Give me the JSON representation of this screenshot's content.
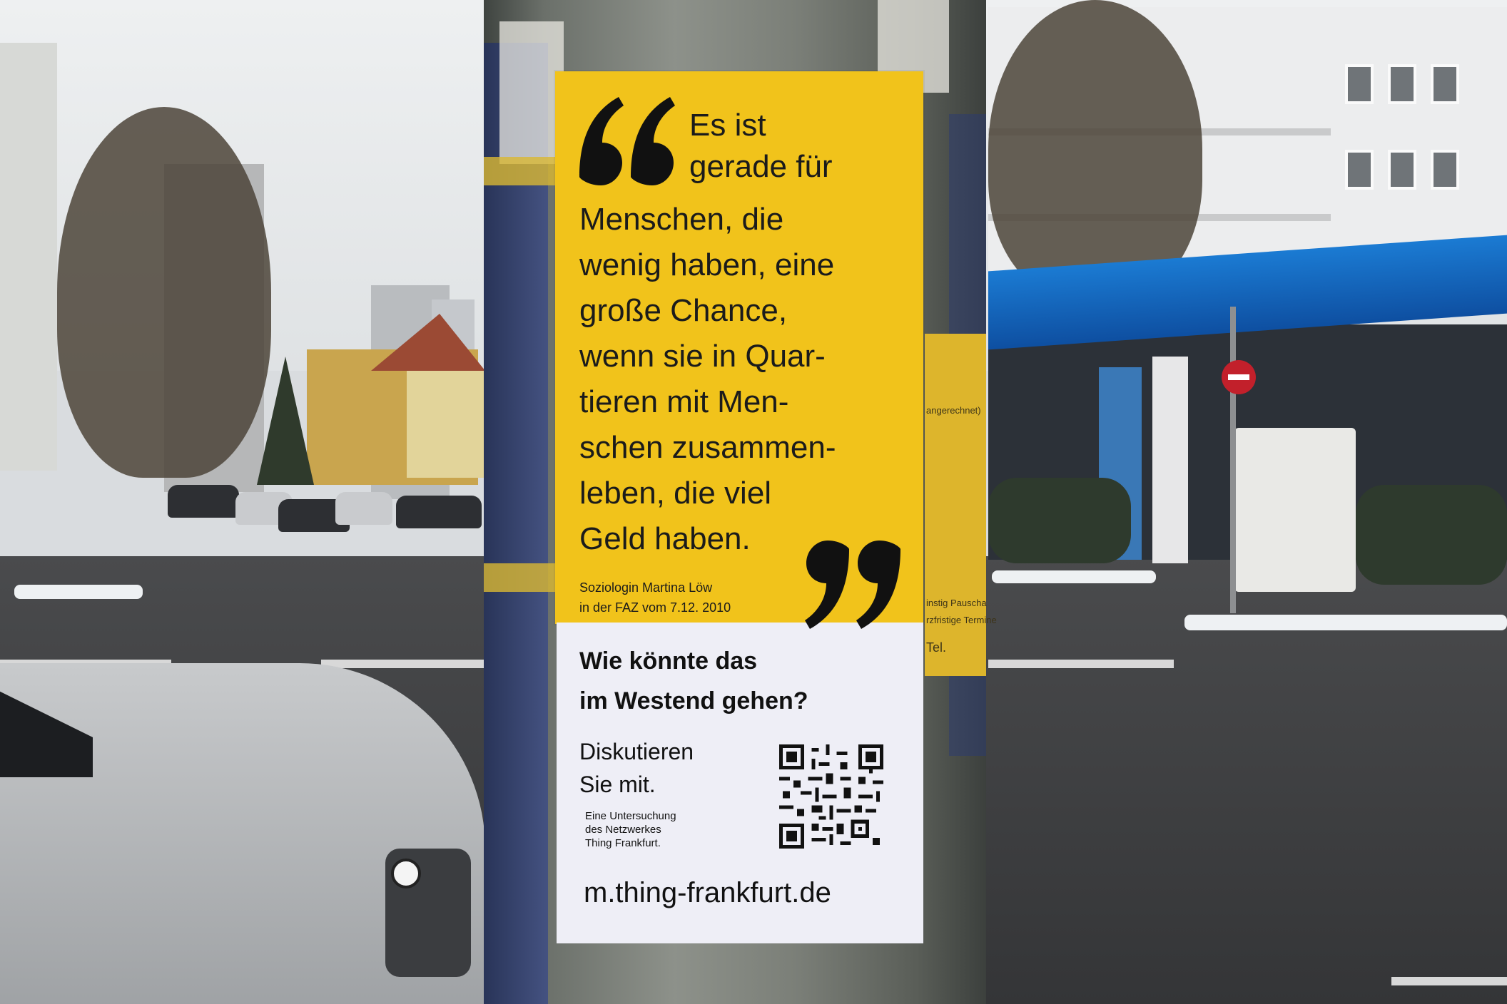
{
  "poster": {
    "quote_lines": [
      "Es ist",
      "gerade für",
      "Menschen, die",
      "wenig haben, eine",
      "große Chance,",
      "wenn sie in Quar-",
      "tieren mit Men-",
      "schen zusammen-",
      "leben, die viel",
      "Geld haben."
    ],
    "source_line1": "Soziologin Martina Löw",
    "source_line2": "in der FAZ vom 7.12. 2010",
    "headline_line1": "Wie könnte das",
    "headline_line2": "im Westend gehen?",
    "discuss_line1": "Diskutieren",
    "discuss_line2": "Sie mit.",
    "study_lines": [
      "Eine Untersuchung",
      "des Netzwerkes",
      "Thing Frankfurt."
    ],
    "url": "m.thing-frankfurt.de",
    "yellow": "#f1c31b",
    "paper": "#eeeef6"
  },
  "side_poster": {
    "text1": "angerechnet)",
    "text2": "instig Pauscha",
    "text3": "rzfristige Termine",
    "text4": "Tel."
  },
  "icons": [
    "quote-open-icon",
    "quote-close-icon",
    "qr-code-icon",
    "no-entry-sign-icon",
    "bmw-badge-icon"
  ]
}
